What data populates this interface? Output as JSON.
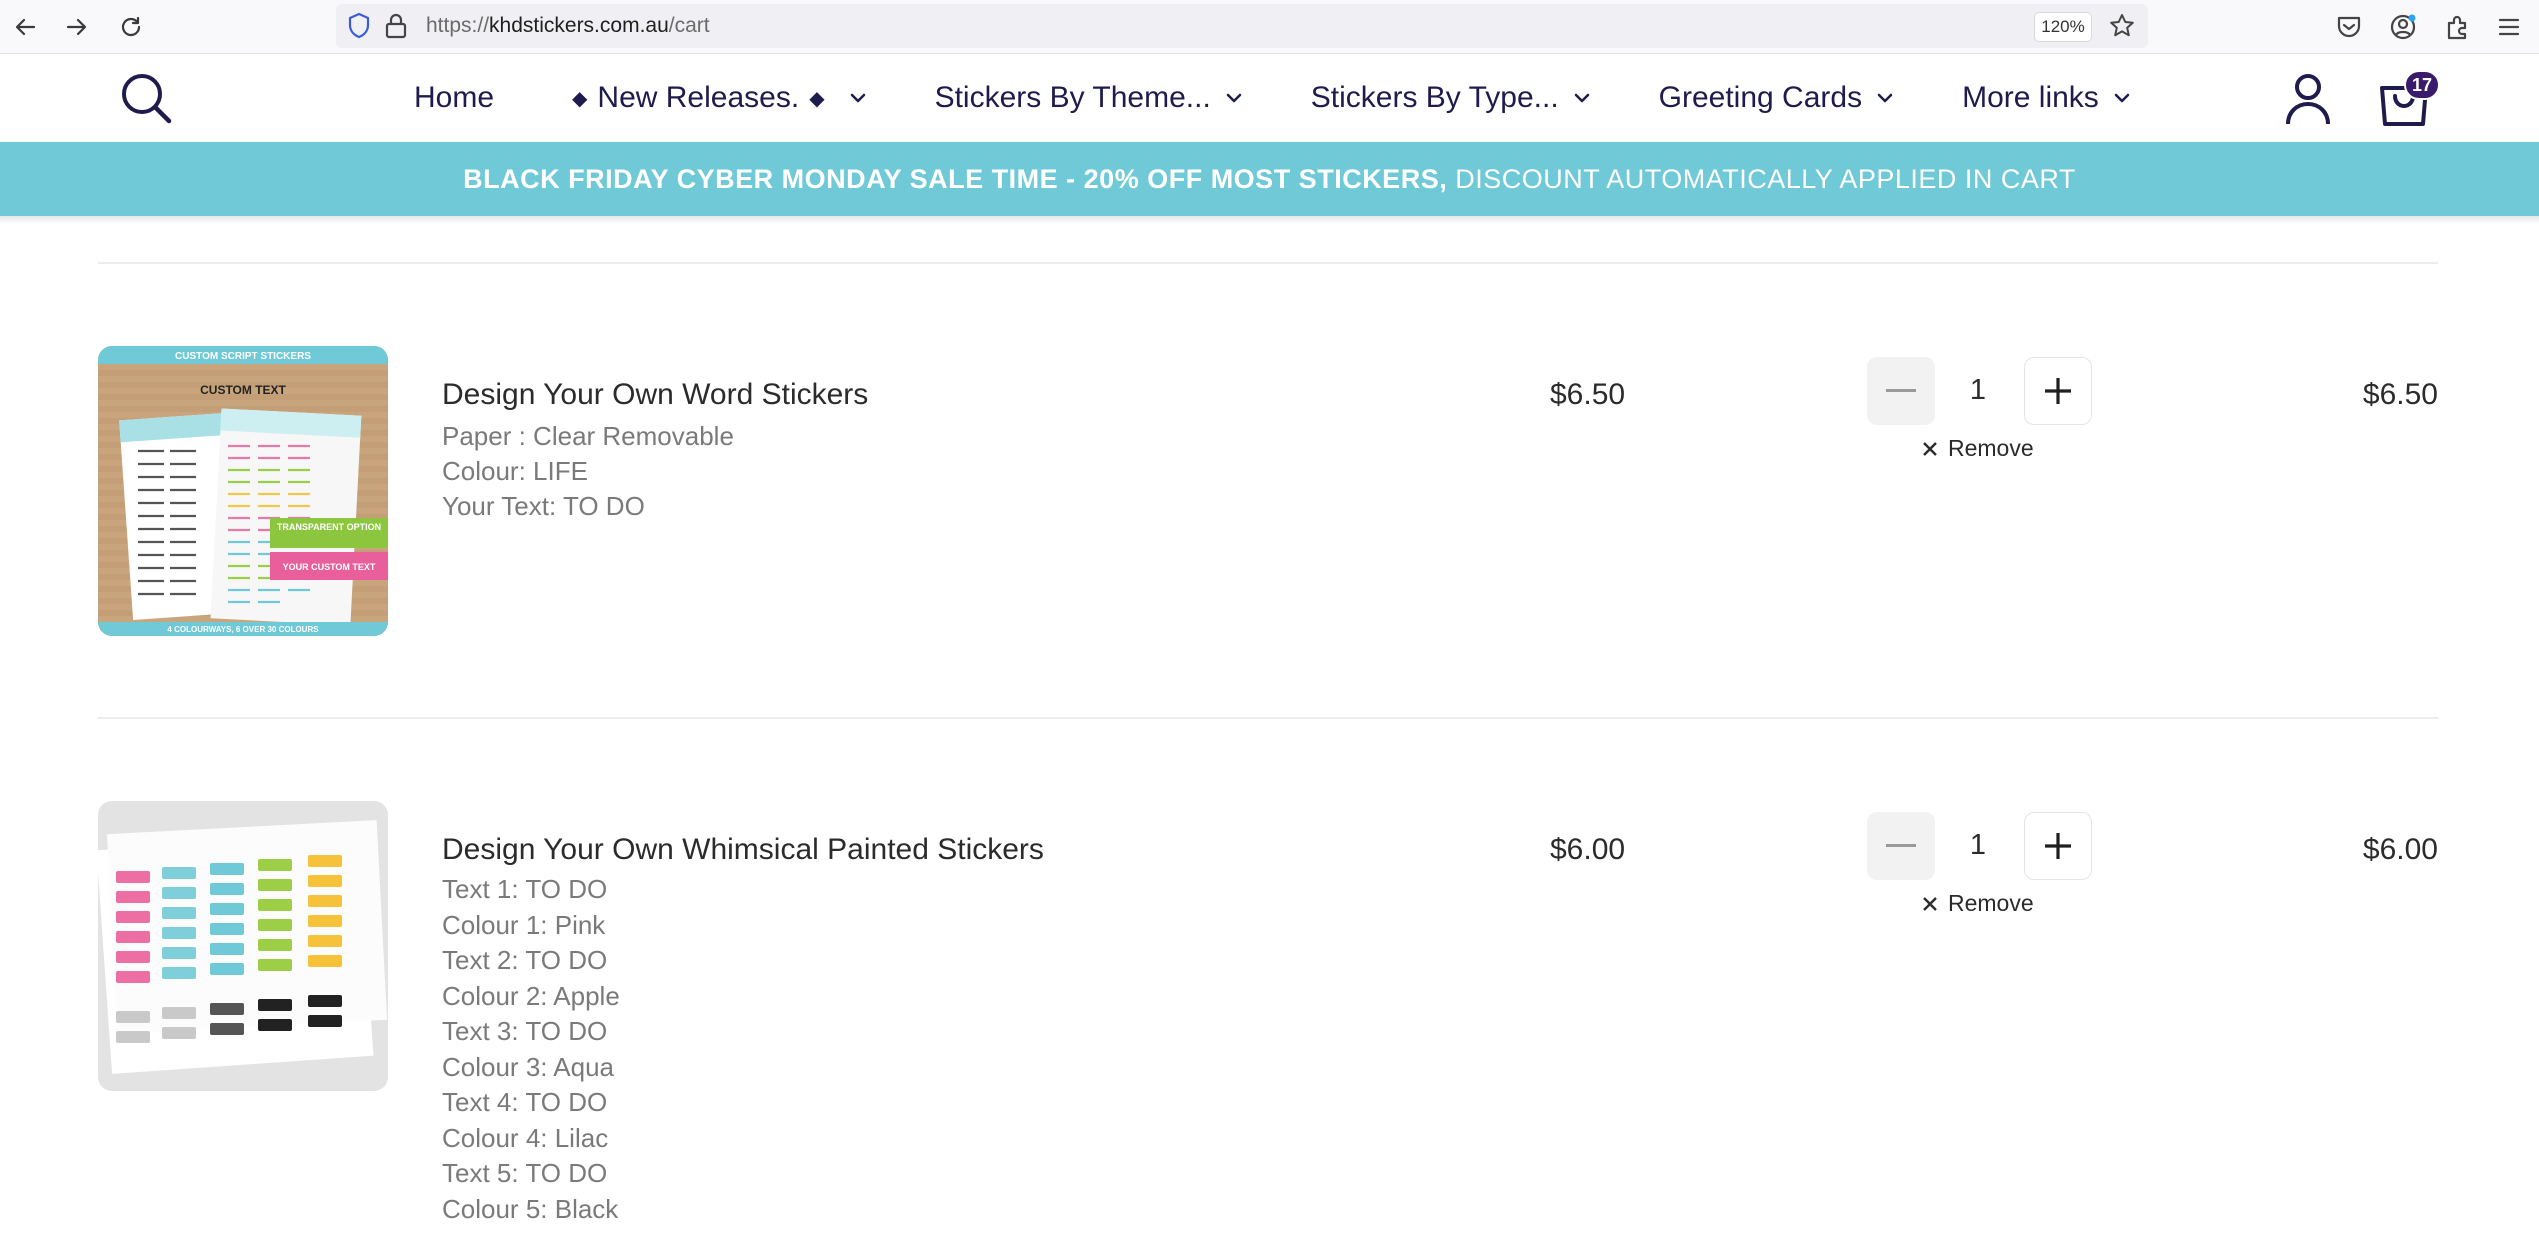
{
  "browser": {
    "url_prefix": "https://",
    "url_domain": "khdstickers.com.au",
    "url_path": "/cart",
    "zoom": "120%"
  },
  "header": {
    "menu": [
      {
        "label": "Home",
        "has_dropdown": false
      },
      {
        "label": "New Releases.",
        "has_dropdown": true,
        "diamonds": true
      },
      {
        "label": "Stickers By Theme...",
        "has_dropdown": true
      },
      {
        "label": "Stickers By Type...",
        "has_dropdown": true
      },
      {
        "label": "Greeting Cards",
        "has_dropdown": true
      },
      {
        "label": "More links",
        "has_dropdown": true
      }
    ],
    "diamond_glyph": "◆",
    "cart_count": "17"
  },
  "banner": {
    "bold_text": "BLACK FRIDAY CYBER MONDAY SALE TIME - 20% OFF MOST STICKERS,",
    "regular_text": "DISCOUNT AUTOMATICALLY APPLIED IN CART"
  },
  "cart": {
    "remove_label": "Remove",
    "items": [
      {
        "title": "Design Your Own Word Stickers",
        "options": [
          "Paper : Clear Removable",
          "Colour: LIFE",
          "Your Text: TO DO"
        ],
        "price": "$6.50",
        "quantity": "1",
        "total": "$6.50",
        "thumb": {
          "top_band": "CUSTOM SCRIPT STICKERS",
          "sheet_heading": "CUSTOM TEXT",
          "tag_green": "TRANSPARENT OPTION",
          "tag_pink": "YOUR CUSTOM TEXT",
          "bottom_band": "4 COLOURWAYS, 6 OVER 30 COLOURS"
        }
      },
      {
        "title": "Design Your Own Whimsical Painted Stickers",
        "options": [
          "Text 1: TO DO",
          "Colour 1: Pink",
          "Text 2: TO DO",
          "Colour 2: Apple",
          "Text 3: TO DO",
          "Colour 3: Aqua",
          "Text 4: TO DO",
          "Colour 4: Lilac",
          "Text 5: TO DO",
          "Colour 5: Black"
        ],
        "price": "$6.00",
        "quantity": "1",
        "total": "$6.00"
      }
    ]
  },
  "colors": {
    "banner_bg": "#6fc9d6",
    "nav_text": "#1f1b4d",
    "cart_badge": "#3a1a6a"
  }
}
